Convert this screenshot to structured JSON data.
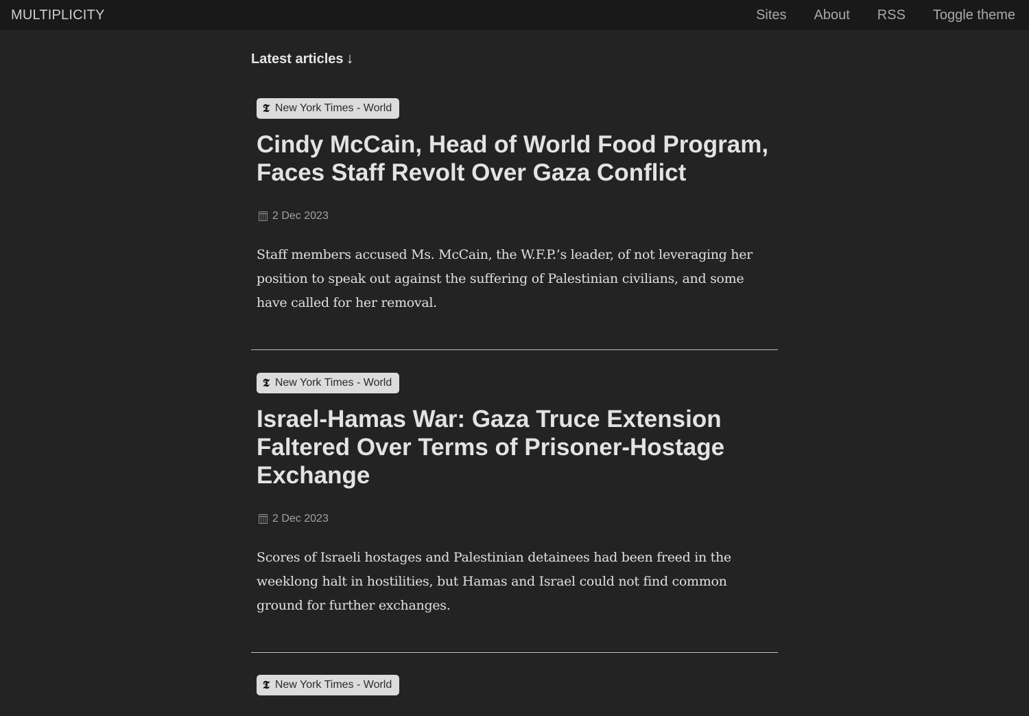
{
  "header": {
    "brand": "MULTIPLICITY",
    "nav": [
      "Sites",
      "About",
      "RSS",
      "Toggle theme"
    ]
  },
  "main": {
    "heading": "Latest articles",
    "heading_arrow": "↓",
    "articles": [
      {
        "source": "New York Times - World",
        "title": "Cindy McCain, Head of World Food Program, Faces Staff Revolt Over Gaza Conflict",
        "date": "2 Dec 2023",
        "summary": "Staff members accused Ms. McCain, the W.F.P.’s leader, of not leveraging her position to speak out against the suffering of Palestinian civilians, and some have called for her removal."
      },
      {
        "source": "New York Times - World",
        "title": "Israel-Hamas War: Gaza Truce Extension Faltered Over Terms of Prisoner-Hostage Exchange",
        "date": "2 Dec 2023",
        "summary": "Scores of Israeli hostages and Palestinian detainees had been freed in the weeklong halt in hostilities, but Hamas and Israel could not find common ground for further exchanges."
      },
      {
        "source": "New York Times - World"
      }
    ]
  },
  "icons": {
    "source": "nyt-logo-icon",
    "date": "calendar-icon"
  },
  "colors": {
    "background": "#232323",
    "topbar": "#191919",
    "badge_bg": "#dcdcdc"
  }
}
